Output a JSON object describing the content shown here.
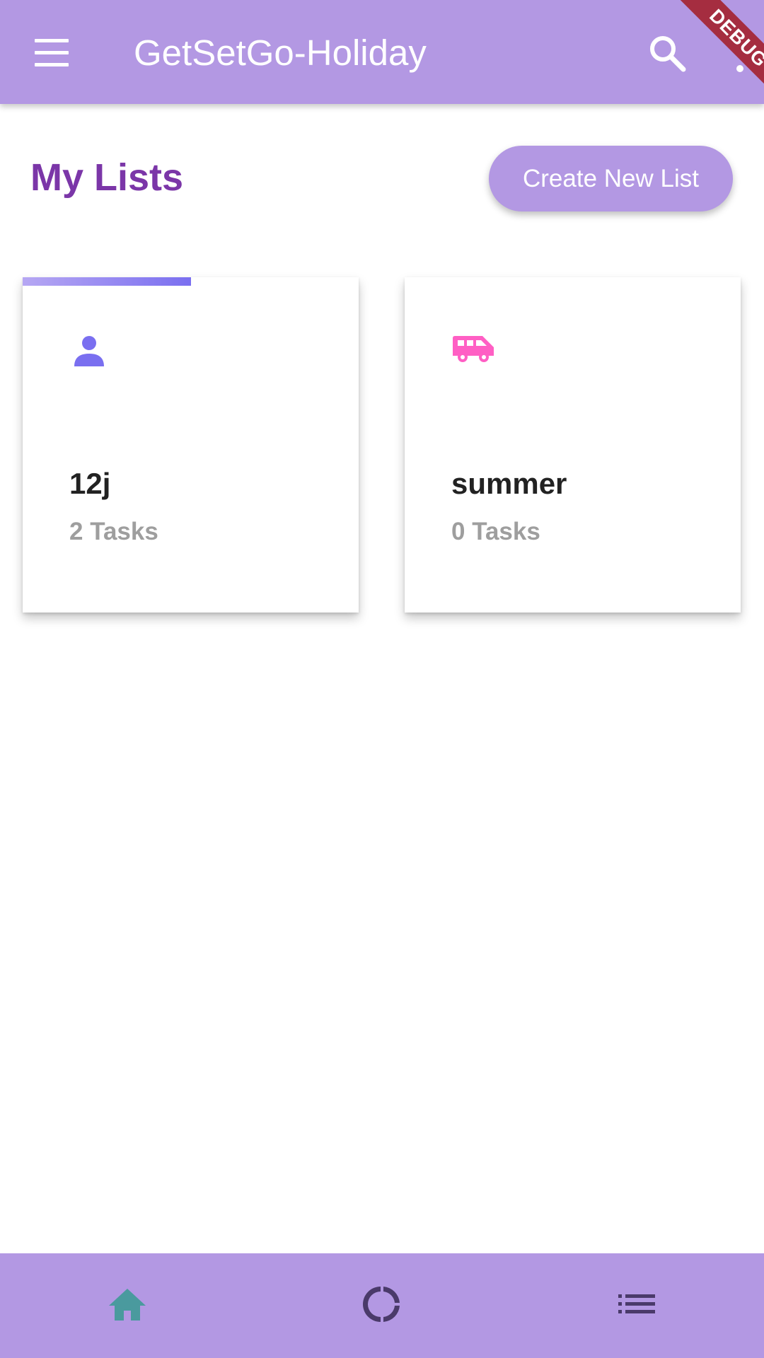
{
  "app_bar": {
    "title": "GetSetGo-Holiday",
    "menu_icon": "menu-icon",
    "search_icon": "search-icon",
    "more_icon": "more-vert-icon",
    "background_color": "#b398e3"
  },
  "debug_banner": {
    "label": "DEBUG",
    "color": "#a52d40"
  },
  "section": {
    "title": "My Lists",
    "create_button_label": "Create New List"
  },
  "lists": [
    {
      "name": "12j",
      "tasks_label": "2 Tasks",
      "icon": "person-icon",
      "icon_color": "#7a6ff0",
      "progress": 0.5
    },
    {
      "name": "summer",
      "tasks_label": "0 Tasks",
      "icon": "van-icon",
      "icon_color": "#ff5fc4",
      "progress": 0
    }
  ],
  "bottom_nav": {
    "items": [
      {
        "icon": "home-icon",
        "color": "#4a9a9e",
        "active": true
      },
      {
        "icon": "donut-chart-icon",
        "color": "#4a3a6a",
        "active": false
      },
      {
        "icon": "list-icon",
        "color": "#4a3a6a",
        "active": false
      }
    ]
  }
}
